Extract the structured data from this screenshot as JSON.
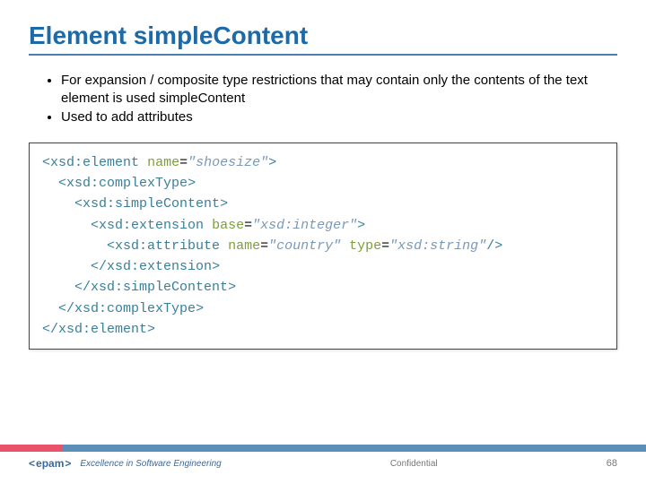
{
  "title": "Element simpleContent",
  "bullets": [
    "For expansion / composite type restrictions that may contain only the contents of the text element is used simpleContent",
    "Used to add attributes"
  ],
  "code": {
    "lines": [
      {
        "indent": 0,
        "parts": [
          {
            "t": "<",
            "c": "tag"
          },
          {
            "t": "xsd:element",
            "c": "tag"
          },
          {
            "t": " "
          },
          {
            "t": "name",
            "c": "attr"
          },
          {
            "t": "="
          },
          {
            "t": "\"shoesize\"",
            "c": "val"
          },
          {
            "t": ">",
            "c": "tag"
          }
        ]
      },
      {
        "indent": 1,
        "parts": [
          {
            "t": "<",
            "c": "tag"
          },
          {
            "t": "xsd:complexType",
            "c": "tag"
          },
          {
            "t": ">",
            "c": "tag"
          }
        ]
      },
      {
        "indent": 2,
        "parts": [
          {
            "t": "<",
            "c": "tag"
          },
          {
            "t": "xsd:simpleContent",
            "c": "tag"
          },
          {
            "t": ">",
            "c": "tag"
          }
        ]
      },
      {
        "indent": 3,
        "parts": [
          {
            "t": "<",
            "c": "tag"
          },
          {
            "t": "xsd:extension",
            "c": "tag"
          },
          {
            "t": " "
          },
          {
            "t": "base",
            "c": "attr"
          },
          {
            "t": "="
          },
          {
            "t": "\"xsd:integer\"",
            "c": "val"
          },
          {
            "t": ">",
            "c": "tag"
          }
        ]
      },
      {
        "indent": 4,
        "parts": [
          {
            "t": "<",
            "c": "tag"
          },
          {
            "t": "xsd:attribute",
            "c": "tag"
          },
          {
            "t": " "
          },
          {
            "t": "name",
            "c": "attr"
          },
          {
            "t": "="
          },
          {
            "t": "\"country\"",
            "c": "val"
          },
          {
            "t": " "
          },
          {
            "t": "type",
            "c": "attr"
          },
          {
            "t": "="
          },
          {
            "t": "\"xsd:string\"",
            "c": "val"
          },
          {
            "t": "/>",
            "c": "tag"
          }
        ]
      },
      {
        "indent": 3,
        "parts": [
          {
            "t": "</",
            "c": "tag"
          },
          {
            "t": "xsd:extension",
            "c": "tag"
          },
          {
            "t": ">",
            "c": "tag"
          }
        ]
      },
      {
        "indent": 2,
        "parts": [
          {
            "t": "</",
            "c": "tag"
          },
          {
            "t": "xsd:simpleContent",
            "c": "tag"
          },
          {
            "t": ">",
            "c": "tag"
          }
        ]
      },
      {
        "indent": 1,
        "parts": [
          {
            "t": "</",
            "c": "tag"
          },
          {
            "t": "xsd:complexType",
            "c": "tag"
          },
          {
            "t": ">",
            "c": "tag"
          }
        ]
      },
      {
        "indent": 0,
        "parts": [
          {
            "t": "</",
            "c": "tag"
          },
          {
            "t": "xsd:element",
            "c": "tag"
          },
          {
            "t": ">",
            "c": "tag"
          }
        ]
      }
    ]
  },
  "footer": {
    "logo_text": "epam",
    "tagline": "Excellence in Software Engineering",
    "confidential": "Confidential",
    "page": "68"
  }
}
